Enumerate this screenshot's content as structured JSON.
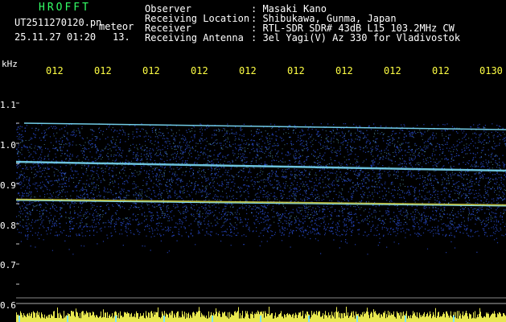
{
  "header": {
    "app_name": "HROFFT",
    "filename": "UT2511270120.pn",
    "mode": "meteor",
    "datetime": "25.11.27 01:20",
    "count": "13.",
    "observer_key": "Observer",
    "observer_val": ": Masaki Kano",
    "location_key": "Receiving Location",
    "location_val": ": Shibukawa, Gunma, Japan",
    "receiver_key": "Receiver",
    "receiver_val": ": RTL-SDR SDR# 43dB L15 103.2MHz CW",
    "antenna_key": "Receiving Antenna",
    "antenna_val": ": 3el Yagi(V) Az 330 for Vladivostok"
  },
  "axis": {
    "unit": "kHz",
    "y_ticks": [
      "1.1",
      "1.0",
      "0.9",
      "0.8",
      "0.7",
      "0.6"
    ],
    "time_ticks": [
      "012",
      "012",
      "012",
      "012",
      "012",
      "012",
      "012",
      "012",
      "012",
      "0130"
    ]
  },
  "colors": {
    "background": "#000000",
    "header_green": "#33ff66",
    "time_yellow": "#ffff44",
    "noise_blue": "#2a4fd8",
    "signal_cyan": "#7fe3ff",
    "signal_yellow": "#e8e850",
    "grid": "#1e6fb0"
  }
}
